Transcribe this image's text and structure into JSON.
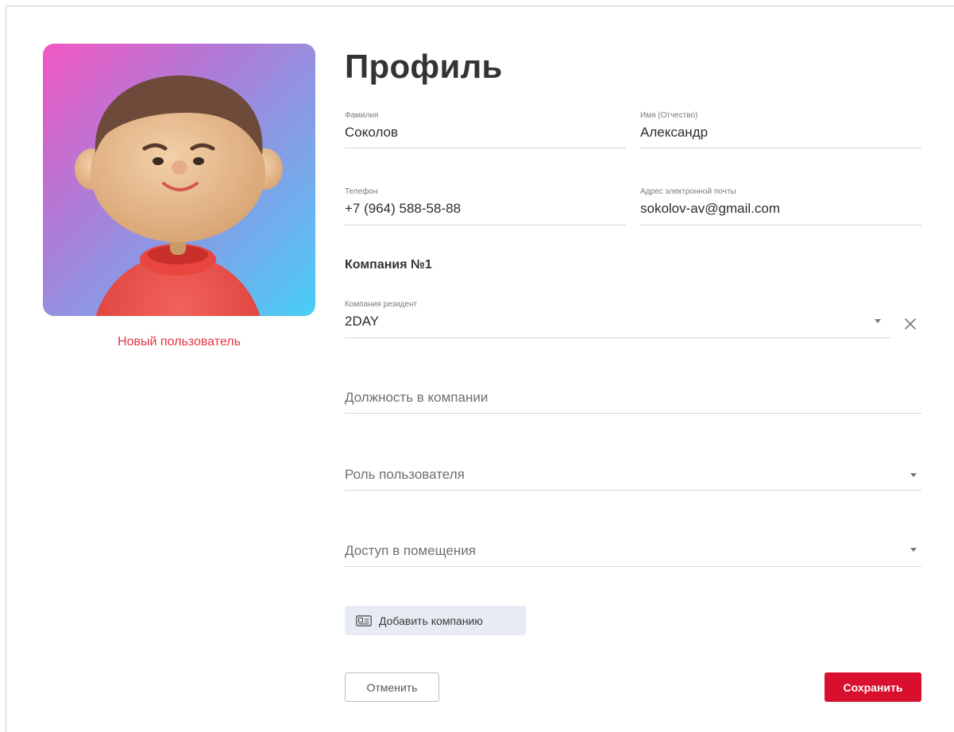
{
  "avatar": {
    "icon": "user-avatar-illustration",
    "status": "Новый пользователь"
  },
  "profile": {
    "title": "Профиль",
    "last_name": {
      "label": "Фамилия",
      "value": "Соколов"
    },
    "first_name": {
      "label": "Имя (Отчество)",
      "value": "Александр"
    },
    "phone": {
      "label": "Телефон",
      "value": "+7 (964) 588-58-88"
    },
    "email": {
      "label": "Адрес электронной почты",
      "value": "sokolov-av@gmail.com"
    }
  },
  "company": {
    "section_title": "Компания №1",
    "resident": {
      "label": "Компания резидент",
      "value": "2DAY"
    },
    "position": {
      "placeholder": "Должность в компании"
    },
    "role": {
      "placeholder": "Роль пользователя"
    },
    "access": {
      "placeholder": "Доступ в помещения"
    }
  },
  "actions": {
    "add_company": "Добавить компанию",
    "cancel": "Отменить",
    "save": "Сохранить"
  },
  "colors": {
    "accent": "#d8102d",
    "status": "#e23545",
    "add_button_bg": "#e7ebf3"
  }
}
